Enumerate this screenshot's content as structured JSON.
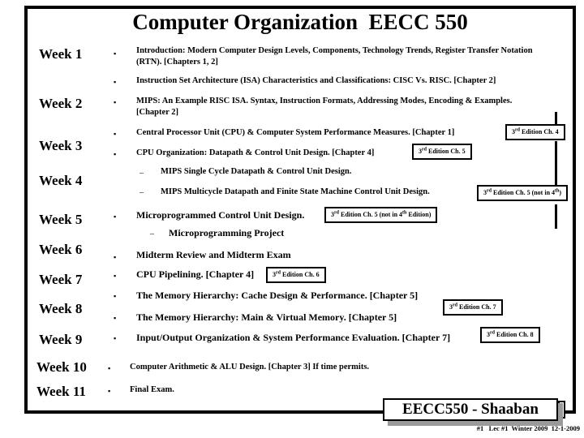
{
  "slide": {
    "title": "Computer Organization  EECC 550",
    "weeks": [
      {
        "label": "Week 1"
      },
      {
        "label": "Week 2"
      },
      {
        "label": "Week 3"
      },
      {
        "label": "Week 4"
      },
      {
        "label": "Week 5"
      },
      {
        "label": "Week 6"
      },
      {
        "label": "Week 7"
      },
      {
        "label": "Week 8"
      },
      {
        "label": "Week 9"
      },
      {
        "label": "Week 10"
      },
      {
        "label": "Week 11"
      }
    ],
    "bullet_glyph": "▪",
    "dash_glyph": "–",
    "items": [
      {
        "text": "Introduction: Modern Computer Design Levels, Components, Technology Trends, Register Transfer Notation  (RTN).  [Chapters 1, 2]"
      },
      {
        "text": "Instruction Set Architecture (ISA) Characteristics and Classifications: CISC Vs. RISC.  [Chapter 2]"
      },
      {
        "text": "MIPS: An Example RISC ISA. Syntax, Instruction Formats, Addressing Modes, Encoding & Examples. [Chapter 2]"
      },
      {
        "text": "Central Processor Unit (CPU) & Computer System Performance Measures.  [Chapter 1]"
      },
      {
        "text": "CPU Organization: Datapath & Control Unit Design.  [Chapter 4]"
      },
      {
        "text": "MIPS Single Cycle Datapath & Control Unit Design."
      },
      {
        "text": "MIPS Multicycle Datapath and Finite State Machine Control Unit Design."
      },
      {
        "text": "Microprogrammed Control Unit Design."
      },
      {
        "text": "Microprogramming Project"
      },
      {
        "text": "Midterm Review and Midterm Exam"
      },
      {
        "text": "CPU Pipelining. [Chapter 4]"
      },
      {
        "text": "The Memory Hierarchy: Cache Design & Performance. [Chapter 5]"
      },
      {
        "text": "The Memory Hierarchy: Main & Virtual Memory. [Chapter 5]"
      },
      {
        "text": "Input/Output Organization & System Performance Evaluation. [Chapter 7]"
      },
      {
        "text": "Computer Arithmetic & ALU Design. [Chapter 3]   If time permits."
      },
      {
        "text": "Final Exam."
      }
    ],
    "edition_boxes": [
      {
        "prefix": "3",
        "sup": "rd",
        "suffix": " Edition Ch. 4"
      },
      {
        "prefix": "3",
        "sup": "rd",
        "suffix": " Edition Ch. 5"
      },
      {
        "prefix": "3",
        "sup": "rd",
        "suffix": " Edition Ch. 5 (not in 4",
        "sup2": "th",
        "suffix2": ")"
      },
      {
        "prefix": "3",
        "sup": "rd",
        "suffix": " Edition Ch. 5 (not in 4",
        "sup2": "th",
        "suffix2": " Edition)"
      },
      {
        "prefix": "3",
        "sup": "rd",
        "suffix": " Edition Ch. 6"
      },
      {
        "prefix": "3",
        "sup": "rd",
        "suffix": " Edition Ch. 7"
      },
      {
        "prefix": "3",
        "sup": "rd",
        "suffix": " Edition Ch. 8"
      }
    ],
    "footer": {
      "banner": "EECC550 - Shaaban",
      "note": "#1   Lec #1  Winter 2009  12-1-2009"
    }
  }
}
